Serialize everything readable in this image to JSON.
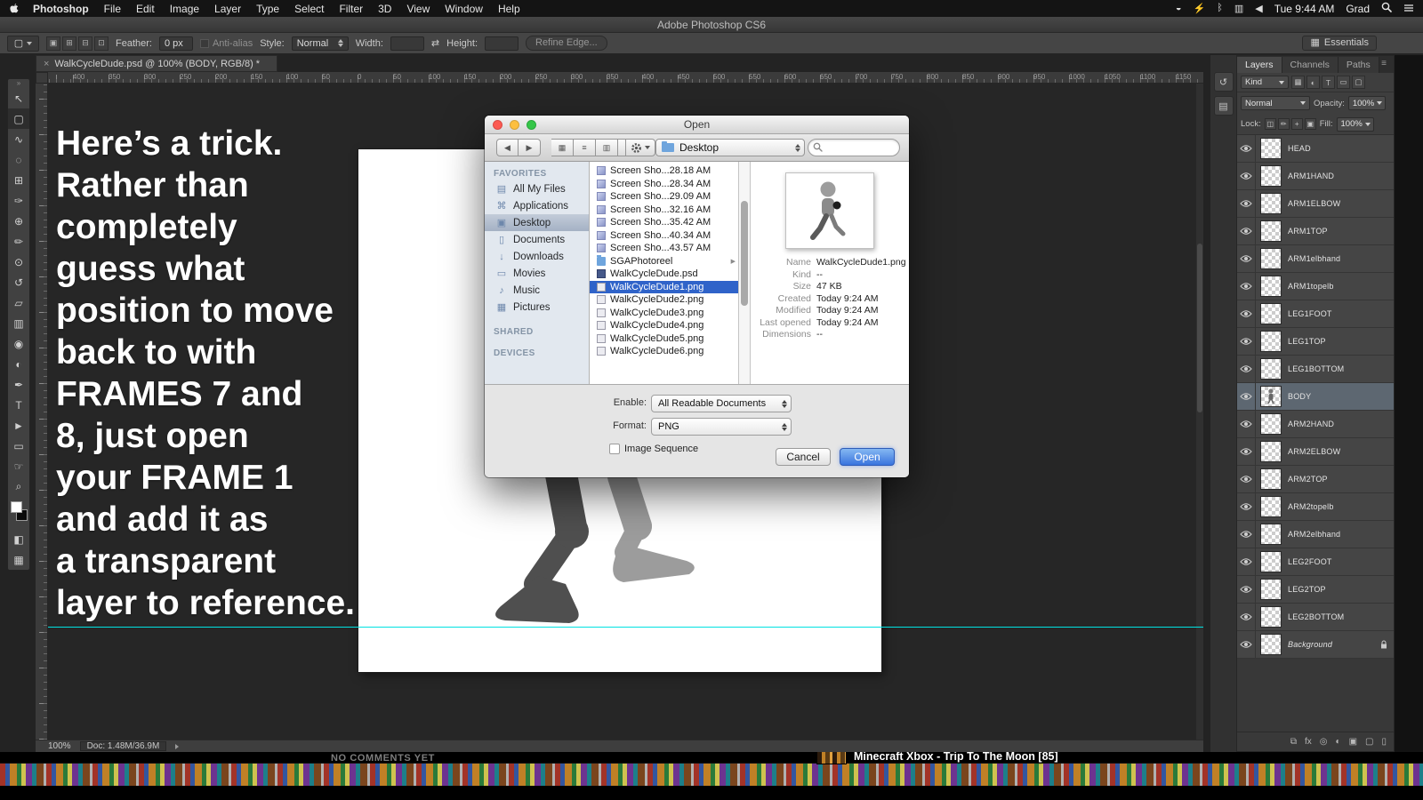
{
  "menu_bar": {
    "app_name": "Photoshop",
    "items": [
      "File",
      "Edit",
      "Image",
      "Layer",
      "Type",
      "Select",
      "Filter",
      "3D",
      "View",
      "Window",
      "Help"
    ],
    "status_icons": [
      "◒",
      "⚡",
      "ᛒ",
      "▥",
      "◀"
    ],
    "time": "Tue 9:44 AM",
    "user": "Grad"
  },
  "window": {
    "title": "Adobe Photoshop CS6"
  },
  "options_bar": {
    "tool_glyph": "▢",
    "mode_icons": [
      "▣",
      "⊞",
      "⊟",
      "⊡"
    ],
    "feather_label": "Feather:",
    "feather_value": "0 px",
    "antialias_label": "Anti-alias",
    "style_label": "Style:",
    "style_value": "Normal",
    "width_label": "Width:",
    "width_value": "",
    "swap_glyph": "⇄",
    "height_label": "Height:",
    "height_value": "",
    "refine_edge_label": "Refine Edge...",
    "workspace_icon": "▦",
    "workspace_label": "Essentials"
  },
  "document_tab": {
    "close_glyph": "×",
    "label": "WalkCycleDude.psd @ 100% (BODY, RGB/8) *"
  },
  "rulers": {
    "horizontal": [
      "400",
      "350",
      "300",
      "250",
      "200",
      "150",
      "100",
      "50",
      "0",
      "50",
      "100",
      "150",
      "200",
      "250",
      "300",
      "350",
      "400",
      "450",
      "500",
      "550",
      "600",
      "650",
      "700",
      "750",
      "800",
      "850",
      "900",
      "950",
      "1000",
      "1050",
      "1100",
      "1150"
    ],
    "vertical": [
      "100",
      "50",
      "0",
      "50",
      "100",
      "150",
      "200",
      "250",
      "300",
      "350",
      "400",
      "450",
      "500",
      "550",
      "600",
      "650",
      "700"
    ]
  },
  "toolbox": {
    "grip": "»",
    "quick_mask_glyph": "◧",
    "screen_mode_glyph": "▦",
    "tools": [
      {
        "name": "move-tool",
        "glyph": "↖"
      },
      {
        "name": "rectangular-marquee-tool",
        "glyph": "▢",
        "selected": true
      },
      {
        "name": "lasso-tool",
        "glyph": "∿"
      },
      {
        "name": "quick-selection-tool",
        "glyph": "◌"
      },
      {
        "name": "crop-tool",
        "glyph": "⊞"
      },
      {
        "name": "eyedropper-tool",
        "glyph": "✑"
      },
      {
        "name": "healing-brush-tool",
        "glyph": "⊕"
      },
      {
        "name": "brush-tool",
        "glyph": "✏"
      },
      {
        "name": "clone-stamp-tool",
        "glyph": "⊙"
      },
      {
        "name": "history-brush-tool",
        "glyph": "↺"
      },
      {
        "name": "eraser-tool",
        "glyph": "▱"
      },
      {
        "name": "gradient-tool",
        "glyph": "▥"
      },
      {
        "name": "blur-tool",
        "glyph": "◉"
      },
      {
        "name": "dodge-tool",
        "glyph": "◐"
      },
      {
        "name": "pen-tool",
        "glyph": "✒"
      },
      {
        "name": "type-tool",
        "glyph": "T"
      },
      {
        "name": "path-selection-tool",
        "glyph": "►"
      },
      {
        "name": "shape-tool",
        "glyph": "▭"
      },
      {
        "name": "hand-tool",
        "glyph": "☞"
      },
      {
        "name": "zoom-tool",
        "glyph": "⌕"
      }
    ]
  },
  "overlay_text": {
    "lines": [
      "Here’s a trick.",
      "Rather than",
      "completely",
      "guess what",
      "position to move",
      "back to with",
      "FRAMES 7 and",
      "8, just open",
      "your FRAME 1",
      "and add it as",
      "a transparent",
      "layer to reference."
    ]
  },
  "open_dialog": {
    "title": "Open",
    "toolbar": {
      "back_glyph": "◀",
      "forward_glyph": "▶",
      "view_glyphs": [
        "▦",
        "≡",
        "▥",
        "▭"
      ],
      "location_value": "Desktop"
    },
    "sidebar": {
      "favorites_header": "FAVORITES",
      "items": [
        {
          "name": "all-my-files",
          "label": "All My Files",
          "icon": "▤"
        },
        {
          "name": "applications",
          "label": "Applications",
          "icon": "⌘"
        },
        {
          "name": "desktop",
          "label": "Desktop",
          "icon": "▣",
          "selected": true
        },
        {
          "name": "documents",
          "label": "Documents",
          "icon": "▯"
        },
        {
          "name": "downloads",
          "label": "Downloads",
          "icon": "↓"
        },
        {
          "name": "movies",
          "label": "Movies",
          "icon": "▭"
        },
        {
          "name": "music",
          "label": "Music",
          "icon": "♪"
        },
        {
          "name": "pictures",
          "label": "Pictures",
          "icon": "▦"
        }
      ],
      "shared_header": "SHARED",
      "devices_header": "DEVICES"
    },
    "files": [
      {
        "name": "Screen Sho...28.18 AM",
        "kind": "screenshot"
      },
      {
        "name": "Screen Sho...28.34 AM",
        "kind": "screenshot"
      },
      {
        "name": "Screen Sho...29.09 AM",
        "kind": "screenshot"
      },
      {
        "name": "Screen Sho...32.16 AM",
        "kind": "screenshot"
      },
      {
        "name": "Screen Sho...35.42 AM",
        "kind": "screenshot"
      },
      {
        "name": "Screen Sho...40.34 AM",
        "kind": "screenshot"
      },
      {
        "name": "Screen Sho...43.57 AM",
        "kind": "screenshot"
      },
      {
        "name": "SGAPhotoreel",
        "kind": "folder",
        "arrow": "▶"
      },
      {
        "name": "WalkCycleDude.psd",
        "kind": "psd"
      },
      {
        "name": "WalkCycleDude1.png",
        "kind": "png",
        "selected": true
      },
      {
        "name": "WalkCycleDude2.png",
        "kind": "png"
      },
      {
        "name": "WalkCycleDude3.png",
        "kind": "png"
      },
      {
        "name": "WalkCycleDude4.png",
        "kind": "png"
      },
      {
        "name": "WalkCycleDude5.png",
        "kind": "png"
      },
      {
        "name": "WalkCycleDude6.png",
        "kind": "png"
      }
    ],
    "preview_info": [
      {
        "label": "Name",
        "value": "WalkCycleDude1.png"
      },
      {
        "label": "Kind",
        "value": "--"
      },
      {
        "label": "Size",
        "value": "47 KB"
      },
      {
        "label": "Created",
        "value": "Today 9:24 AM"
      },
      {
        "label": "Modified",
        "value": "Today 9:24 AM"
      },
      {
        "label": "Last opened",
        "value": "Today 9:24 AM"
      },
      {
        "label": "Dimensions",
        "value": "--"
      }
    ],
    "enable_label": "Enable:",
    "enable_value": "All Readable Documents",
    "format_label": "Format:",
    "format_value": "PNG",
    "image_sequence_label": "Image Sequence",
    "cancel_label": "Cancel",
    "open_label": "Open"
  },
  "panel_dock": [
    {
      "name": "history-panel-icon",
      "glyph": "↺"
    },
    {
      "name": "properties-panel-icon",
      "glyph": "▤"
    }
  ],
  "layers_panel": {
    "tabs": [
      {
        "label": "Layers",
        "active": true
      },
      {
        "label": "Channels"
      },
      {
        "label": "Paths"
      }
    ],
    "menu_glyph": "≡",
    "filter_label": "Kind",
    "filter_icons": [
      "▦",
      "◐",
      "T",
      "▭",
      "▢"
    ],
    "blend_mode": "Normal",
    "opacity_label": "Opacity:",
    "opacity_value": "100%",
    "lock_label": "Lock:",
    "lock_icons": [
      "◫",
      "✏",
      "+",
      "▣"
    ],
    "fill_label": "Fill:",
    "fill_value": "100%",
    "layers": [
      {
        "name": "HEAD"
      },
      {
        "name": "ARM1HAND"
      },
      {
        "name": "ARM1ELBOW"
      },
      {
        "name": "ARM1TOP"
      },
      {
        "name": "ARM1elbhand"
      },
      {
        "name": "ARM1topelb"
      },
      {
        "name": "LEG1FOOT"
      },
      {
        "name": "LEG1TOP"
      },
      {
        "name": "LEG1BOTTOM"
      },
      {
        "name": "BODY",
        "selected": true,
        "figure": true
      },
      {
        "name": "ARM2HAND"
      },
      {
        "name": "ARM2ELBOW"
      },
      {
        "name": "ARM2TOP"
      },
      {
        "name": "ARM2topelb"
      },
      {
        "name": "ARM2elbhand"
      },
      {
        "name": "LEG2FOOT"
      },
      {
        "name": "LEG2TOP"
      },
      {
        "name": "LEG2BOTTOM"
      },
      {
        "name": "Background",
        "locked": true,
        "italic": true
      }
    ],
    "bottom_icons": [
      "⧉",
      "fx",
      "◎",
      "◐",
      "▣",
      "▢",
      "▯"
    ]
  },
  "status_bar": {
    "zoom": "100%",
    "doc_info": "Doc: 1.48M/36.9M"
  },
  "page_background": {
    "comments_text": "NO COMMENTS YET",
    "suggestion_title": "Minecraft Xbox - Trip To The Moon [85]"
  },
  "colors": {
    "selection_blue": "#2f63c9",
    "guide_cyan": "#00e2e2",
    "open_button_blue": "#3a74de"
  }
}
